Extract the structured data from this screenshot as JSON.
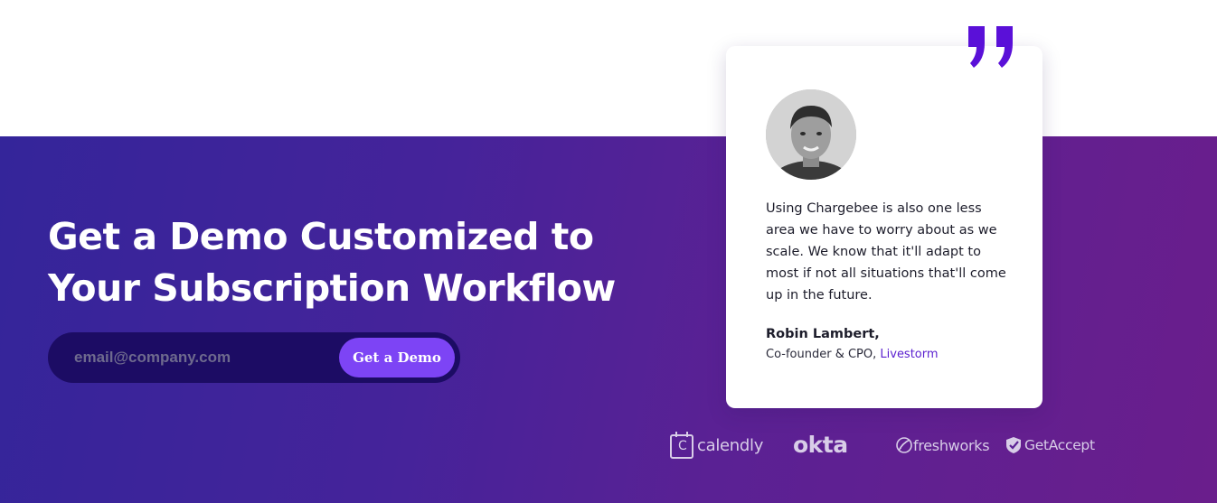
{
  "hero": {
    "headline_line1": "Get a Demo Customized to",
    "headline_line2": "Your Subscription Workflow",
    "email_placeholder": "email@company.com",
    "cta_label": "Get a Demo"
  },
  "testimonial": {
    "quote": "Using Chargebee is also one less area we have to worry about as we scale. We know that it'll adapt to most if not all situations that'll come up in the future.",
    "author_name": "Robin Lambert,",
    "author_role": "Co-founder & CPO,",
    "company": "Livestorm",
    "avatar_icon": "person-photo-icon",
    "quote_icon": "quote-mark-icon"
  },
  "logos": [
    {
      "name": "calendly",
      "label": "calendly",
      "mark_letter": "C"
    },
    {
      "name": "okta",
      "label": "okta"
    },
    {
      "name": "freshworks",
      "label": "freshworks"
    },
    {
      "name": "getaccept",
      "label": "GetAccept"
    }
  ],
  "colors": {
    "accent": "#7d44f5",
    "quote_mark": "#5a10d8",
    "link": "#5a1fcf",
    "gradient_start": "#34259a",
    "gradient_end": "#6a1e8c",
    "form_bg": "#1c0c64"
  }
}
